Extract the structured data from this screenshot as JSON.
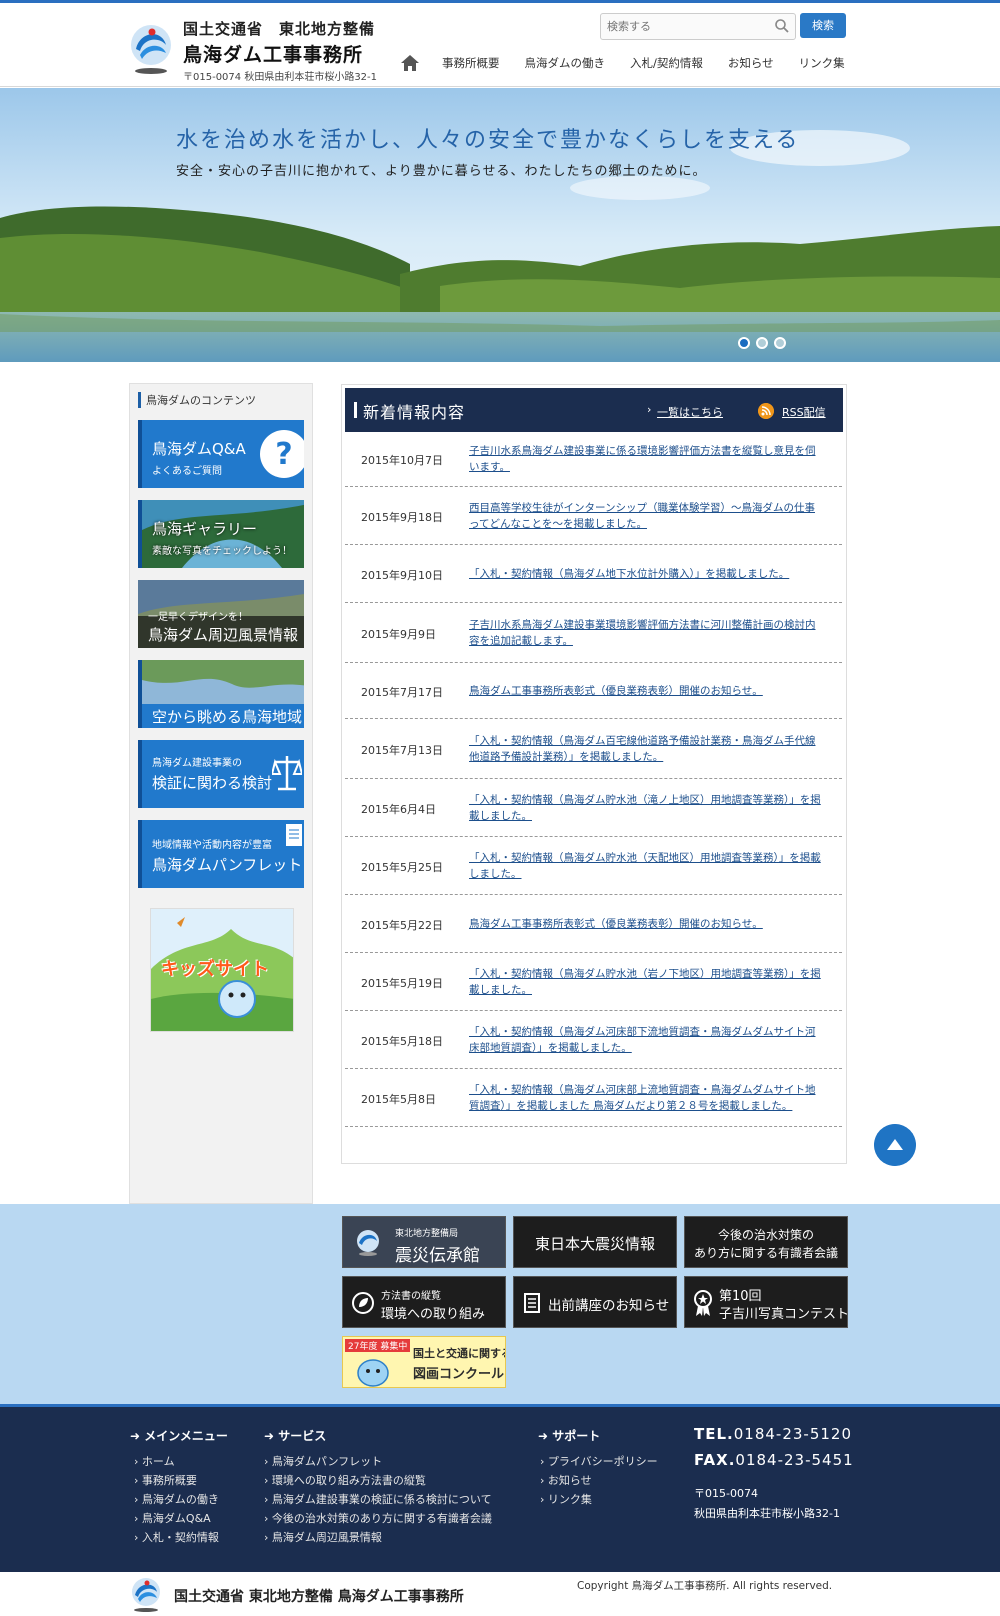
{
  "header": {
    "org_line1": "国土交通省　東北地方整備",
    "org_line2": "鳥海ダム工事事務所",
    "address": "〒015-0074 秋田県由利本荘市桜小路32-1",
    "search_placeholder": "検索する",
    "search_button": "検索",
    "nav": [
      "事務所概要",
      "鳥海ダムの働き",
      "入札/契約情報",
      "お知らせ",
      "リンク集"
    ]
  },
  "hero": {
    "title": "水を治め水を活かし、人々の安全で豊かなくらしを支える",
    "subtitle": "安全・安心の子吉川に抱かれて、より豊かに暮らせる、わたしたちの郷土のために。",
    "slide_count": 3,
    "active_slide": 1
  },
  "sidebar": {
    "title": "鳥海ダムのコンテンツ",
    "banners": [
      {
        "line1": "鳥海ダムQ&A",
        "line2": "よくあるご質問"
      },
      {
        "line1": "鳥海ギャラリー",
        "line2": "素敵な写真をチェックしよう！"
      },
      {
        "line1": "一足早くデザインを！",
        "line2": "鳥海ダム周辺風景情報"
      },
      {
        "line1": "空から眺める鳥海地域",
        "line2": ""
      },
      {
        "line1": "鳥海ダム建設事業の",
        "line2": "検証に関わる検討"
      },
      {
        "line1": "地域情報や活動内容が豊富",
        "line2": "鳥海ダムパンフレット"
      }
    ],
    "kids_label": "キッズサイト"
  },
  "news": {
    "title": "新着情報内容",
    "list_link": "一覧はこちら",
    "rss_link": "RSS配信",
    "items": [
      {
        "date": "2015年10月7日",
        "text": "子吉川水系鳥海ダム建設事業に係る環境影響評価方法書を縦覧し意見を伺います。"
      },
      {
        "date": "2015年9月18日",
        "text": "西目高等学校生徒がインターンシップ（職業体験学習）～鳥海ダムの仕事ってどんなことを～を掲載しました。"
      },
      {
        "date": "2015年9月10日",
        "text": "「入札・契約情報（鳥海ダム地下水位計外購入）」を掲載しました。"
      },
      {
        "date": "2015年9月9日",
        "text": "子吉川水系鳥海ダム建設事業環境影響評価方法書に河川整備計画の検討内容を追加記載します。"
      },
      {
        "date": "2015年7月17日",
        "text": "鳥海ダム工事事務所表彰式（優良業務表彰）開催のお知らせ。"
      },
      {
        "date": "2015年7月13日",
        "text": "「入札・契約情報（鳥海ダム百宅線他道路予備設計業務・鳥海ダム手代線他道路予備設計業務）」を掲載しました。"
      },
      {
        "date": "2015年6月4日",
        "text": "「入札・契約情報（鳥海ダム貯水池（滝ノ上地区）用地調査等業務）」を掲載しました。"
      },
      {
        "date": "2015年5月25日",
        "text": "「入札・契約情報（鳥海ダム貯水池（天配地区）用地調査等業務）」を掲載しました。"
      },
      {
        "date": "2015年5月22日",
        "text": "鳥海ダム工事事務所表彰式（優良業務表彰）開催のお知らせ。"
      },
      {
        "date": "2015年5月19日",
        "text": "「入札・契約情報（鳥海ダム貯水池（岩ノ下地区）用地調査等業務）」を掲載しました。"
      },
      {
        "date": "2015年5月18日",
        "text": "「入札・契約情報（鳥海ダム河床部下流地質調査・鳥海ダムダムサイト河床部地質調査）」を掲載しました。"
      },
      {
        "date": "2015年5月8日",
        "text": "「入札・契約情報（鳥海ダム河床部上流地質調査・鳥海ダムダムサイト地質調査）」を掲載しました 鳥海ダムだより第２８号を掲載しました。"
      }
    ]
  },
  "banners": {
    "b1_small": "東北地方整備局",
    "b1_big": "震災伝承館",
    "b2_big": "東日本大震災情報",
    "b3_line1": "今後の治水対策の",
    "b3_line2": "あり方に関する有識者会議",
    "b4_small": "方法書の縦覧",
    "b4_big": "環境への取り組み",
    "b5_big": "出前講座のお知らせ",
    "b6_line1": "第10回",
    "b6_line2": "子吉川写真コンテスト",
    "b7_tag": "27年度 募集中",
    "b7_line1": "国土と交通に関する",
    "b7_line2": "図画コンクール"
  },
  "footer": {
    "main_title": "メインメニュー",
    "main_items": [
      "ホーム",
      "事務所概要",
      "鳥海ダムの働き",
      "鳥海ダムQ&A",
      "入札・契約情報"
    ],
    "service_title": "サービス",
    "service_items": [
      "鳥海ダムパンフレット",
      "環境への取り組み方法書の縦覧",
      "鳥海ダム建設事業の検証に係る検討について",
      "今後の治水対策のあり方に関する有識者会議",
      "鳥海ダム周辺風景情報"
    ],
    "support_title": "サポート",
    "support_items": [
      "プライバシーポリシー",
      "お知らせ",
      "リンク集"
    ],
    "tel_label": "TEL.",
    "tel": "0184-23-5120",
    "fax_label": "FAX.",
    "fax": "0184-23-5451",
    "postal": "〒015-0074",
    "address": "秋田県由利本荘市桜小路32-1"
  },
  "bottom": {
    "org_name": "国土交通省 東北地方整備 鳥海ダム工事事務所",
    "copyright": "Copyright 鳥海ダム工事事務所. All rights reserved."
  },
  "colors": {
    "accent": "#2a79c6",
    "navy": "#1b2d4f",
    "band": "#b9d8f2",
    "link": "#1d4f8c"
  }
}
